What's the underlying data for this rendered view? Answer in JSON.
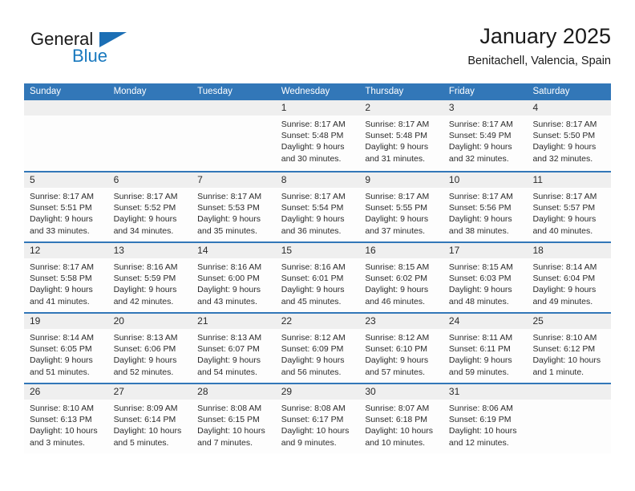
{
  "brand": {
    "name_top": "General",
    "name_bottom": "Blue",
    "accent_color": "#1878be",
    "triangle_color": "#1c6fb5"
  },
  "header": {
    "title": "January 2025",
    "subtitle": "Benitachell, Valencia, Spain"
  },
  "theme": {
    "header_bar_color": "#3277b8",
    "date_band_color": "#efefef",
    "cell_background": "#fdfdfd",
    "text_color": "#2b2b2b"
  },
  "weekdays": [
    "Sunday",
    "Monday",
    "Tuesday",
    "Wednesday",
    "Thursday",
    "Friday",
    "Saturday"
  ],
  "weeks": [
    [
      {
        "day": "",
        "empty": true,
        "sunrise": "",
        "sunset": "",
        "daylight_1": "",
        "daylight_2": ""
      },
      {
        "day": "",
        "empty": true,
        "sunrise": "",
        "sunset": "",
        "daylight_1": "",
        "daylight_2": ""
      },
      {
        "day": "",
        "empty": true,
        "sunrise": "",
        "sunset": "",
        "daylight_1": "",
        "daylight_2": ""
      },
      {
        "day": "1",
        "empty": false,
        "sunrise": "Sunrise: 8:17 AM",
        "sunset": "Sunset: 5:48 PM",
        "daylight_1": "Daylight: 9 hours",
        "daylight_2": "and 30 minutes."
      },
      {
        "day": "2",
        "empty": false,
        "sunrise": "Sunrise: 8:17 AM",
        "sunset": "Sunset: 5:48 PM",
        "daylight_1": "Daylight: 9 hours",
        "daylight_2": "and 31 minutes."
      },
      {
        "day": "3",
        "empty": false,
        "sunrise": "Sunrise: 8:17 AM",
        "sunset": "Sunset: 5:49 PM",
        "daylight_1": "Daylight: 9 hours",
        "daylight_2": "and 32 minutes."
      },
      {
        "day": "4",
        "empty": false,
        "sunrise": "Sunrise: 8:17 AM",
        "sunset": "Sunset: 5:50 PM",
        "daylight_1": "Daylight: 9 hours",
        "daylight_2": "and 32 minutes."
      }
    ],
    [
      {
        "day": "5",
        "empty": false,
        "sunrise": "Sunrise: 8:17 AM",
        "sunset": "Sunset: 5:51 PM",
        "daylight_1": "Daylight: 9 hours",
        "daylight_2": "and 33 minutes."
      },
      {
        "day": "6",
        "empty": false,
        "sunrise": "Sunrise: 8:17 AM",
        "sunset": "Sunset: 5:52 PM",
        "daylight_1": "Daylight: 9 hours",
        "daylight_2": "and 34 minutes."
      },
      {
        "day": "7",
        "empty": false,
        "sunrise": "Sunrise: 8:17 AM",
        "sunset": "Sunset: 5:53 PM",
        "daylight_1": "Daylight: 9 hours",
        "daylight_2": "and 35 minutes."
      },
      {
        "day": "8",
        "empty": false,
        "sunrise": "Sunrise: 8:17 AM",
        "sunset": "Sunset: 5:54 PM",
        "daylight_1": "Daylight: 9 hours",
        "daylight_2": "and 36 minutes."
      },
      {
        "day": "9",
        "empty": false,
        "sunrise": "Sunrise: 8:17 AM",
        "sunset": "Sunset: 5:55 PM",
        "daylight_1": "Daylight: 9 hours",
        "daylight_2": "and 37 minutes."
      },
      {
        "day": "10",
        "empty": false,
        "sunrise": "Sunrise: 8:17 AM",
        "sunset": "Sunset: 5:56 PM",
        "daylight_1": "Daylight: 9 hours",
        "daylight_2": "and 38 minutes."
      },
      {
        "day": "11",
        "empty": false,
        "sunrise": "Sunrise: 8:17 AM",
        "sunset": "Sunset: 5:57 PM",
        "daylight_1": "Daylight: 9 hours",
        "daylight_2": "and 40 minutes."
      }
    ],
    [
      {
        "day": "12",
        "empty": false,
        "sunrise": "Sunrise: 8:17 AM",
        "sunset": "Sunset: 5:58 PM",
        "daylight_1": "Daylight: 9 hours",
        "daylight_2": "and 41 minutes."
      },
      {
        "day": "13",
        "empty": false,
        "sunrise": "Sunrise: 8:16 AM",
        "sunset": "Sunset: 5:59 PM",
        "daylight_1": "Daylight: 9 hours",
        "daylight_2": "and 42 minutes."
      },
      {
        "day": "14",
        "empty": false,
        "sunrise": "Sunrise: 8:16 AM",
        "sunset": "Sunset: 6:00 PM",
        "daylight_1": "Daylight: 9 hours",
        "daylight_2": "and 43 minutes."
      },
      {
        "day": "15",
        "empty": false,
        "sunrise": "Sunrise: 8:16 AM",
        "sunset": "Sunset: 6:01 PM",
        "daylight_1": "Daylight: 9 hours",
        "daylight_2": "and 45 minutes."
      },
      {
        "day": "16",
        "empty": false,
        "sunrise": "Sunrise: 8:15 AM",
        "sunset": "Sunset: 6:02 PM",
        "daylight_1": "Daylight: 9 hours",
        "daylight_2": "and 46 minutes."
      },
      {
        "day": "17",
        "empty": false,
        "sunrise": "Sunrise: 8:15 AM",
        "sunset": "Sunset: 6:03 PM",
        "daylight_1": "Daylight: 9 hours",
        "daylight_2": "and 48 minutes."
      },
      {
        "day": "18",
        "empty": false,
        "sunrise": "Sunrise: 8:14 AM",
        "sunset": "Sunset: 6:04 PM",
        "daylight_1": "Daylight: 9 hours",
        "daylight_2": "and 49 minutes."
      }
    ],
    [
      {
        "day": "19",
        "empty": false,
        "sunrise": "Sunrise: 8:14 AM",
        "sunset": "Sunset: 6:05 PM",
        "daylight_1": "Daylight: 9 hours",
        "daylight_2": "and 51 minutes."
      },
      {
        "day": "20",
        "empty": false,
        "sunrise": "Sunrise: 8:13 AM",
        "sunset": "Sunset: 6:06 PM",
        "daylight_1": "Daylight: 9 hours",
        "daylight_2": "and 52 minutes."
      },
      {
        "day": "21",
        "empty": false,
        "sunrise": "Sunrise: 8:13 AM",
        "sunset": "Sunset: 6:07 PM",
        "daylight_1": "Daylight: 9 hours",
        "daylight_2": "and 54 minutes."
      },
      {
        "day": "22",
        "empty": false,
        "sunrise": "Sunrise: 8:12 AM",
        "sunset": "Sunset: 6:09 PM",
        "daylight_1": "Daylight: 9 hours",
        "daylight_2": "and 56 minutes."
      },
      {
        "day": "23",
        "empty": false,
        "sunrise": "Sunrise: 8:12 AM",
        "sunset": "Sunset: 6:10 PM",
        "daylight_1": "Daylight: 9 hours",
        "daylight_2": "and 57 minutes."
      },
      {
        "day": "24",
        "empty": false,
        "sunrise": "Sunrise: 8:11 AM",
        "sunset": "Sunset: 6:11 PM",
        "daylight_1": "Daylight: 9 hours",
        "daylight_2": "and 59 minutes."
      },
      {
        "day": "25",
        "empty": false,
        "sunrise": "Sunrise: 8:10 AM",
        "sunset": "Sunset: 6:12 PM",
        "daylight_1": "Daylight: 10 hours",
        "daylight_2": "and 1 minute."
      }
    ],
    [
      {
        "day": "26",
        "empty": false,
        "sunrise": "Sunrise: 8:10 AM",
        "sunset": "Sunset: 6:13 PM",
        "daylight_1": "Daylight: 10 hours",
        "daylight_2": "and 3 minutes."
      },
      {
        "day": "27",
        "empty": false,
        "sunrise": "Sunrise: 8:09 AM",
        "sunset": "Sunset: 6:14 PM",
        "daylight_1": "Daylight: 10 hours",
        "daylight_2": "and 5 minutes."
      },
      {
        "day": "28",
        "empty": false,
        "sunrise": "Sunrise: 8:08 AM",
        "sunset": "Sunset: 6:15 PM",
        "daylight_1": "Daylight: 10 hours",
        "daylight_2": "and 7 minutes."
      },
      {
        "day": "29",
        "empty": false,
        "sunrise": "Sunrise: 8:08 AM",
        "sunset": "Sunset: 6:17 PM",
        "daylight_1": "Daylight: 10 hours",
        "daylight_2": "and 9 minutes."
      },
      {
        "day": "30",
        "empty": false,
        "sunrise": "Sunrise: 8:07 AM",
        "sunset": "Sunset: 6:18 PM",
        "daylight_1": "Daylight: 10 hours",
        "daylight_2": "and 10 minutes."
      },
      {
        "day": "31",
        "empty": false,
        "sunrise": "Sunrise: 8:06 AM",
        "sunset": "Sunset: 6:19 PM",
        "daylight_1": "Daylight: 10 hours",
        "daylight_2": "and 12 minutes."
      },
      {
        "day": "",
        "empty": true,
        "sunrise": "",
        "sunset": "",
        "daylight_1": "",
        "daylight_2": ""
      }
    ]
  ]
}
